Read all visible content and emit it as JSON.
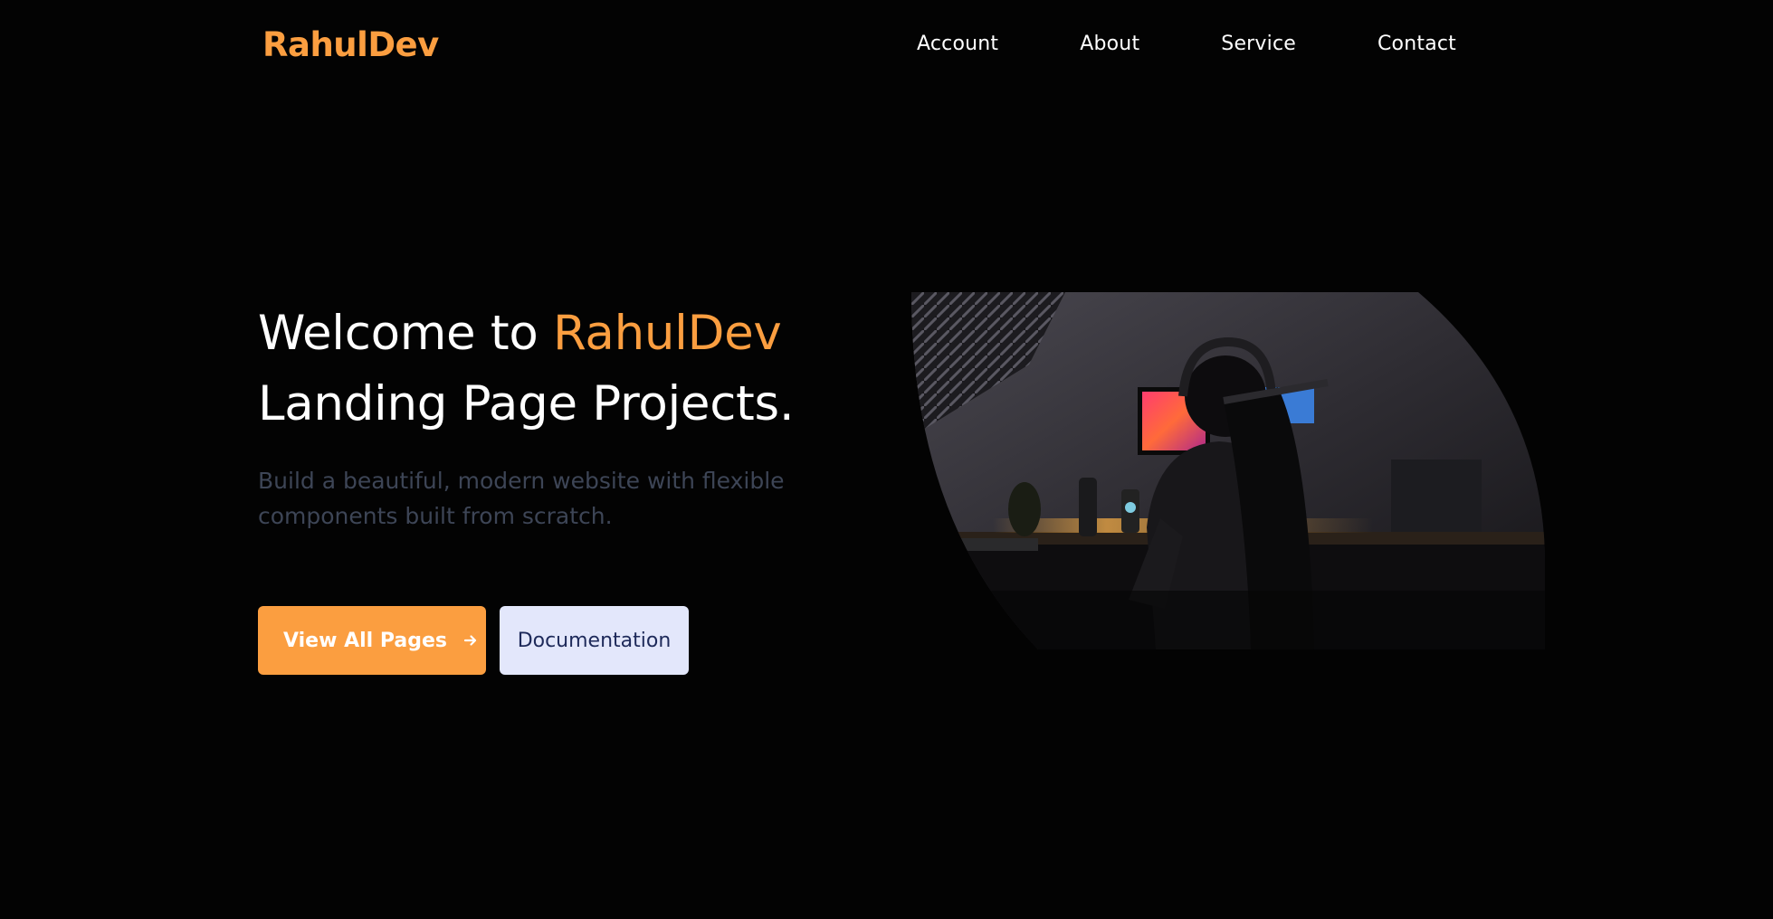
{
  "header": {
    "logo": "RahulDev",
    "nav": [
      "Account",
      "About",
      "Service",
      "Contact"
    ]
  },
  "hero": {
    "title_prefix": "Welcome to ",
    "title_accent": "RahulDev",
    "title_line2": "Landing Page Projects.",
    "subtitle": "Build a beautiful, modern website with flexible components built from scratch.",
    "primary_button": "View All Pages",
    "secondary_button": "Documentation"
  },
  "colors": {
    "accent": "#fb9e40",
    "background": "#030303",
    "subtitle": "#3d4556",
    "secondary_button_bg": "#e3e7fb",
    "secondary_button_text": "#1e2a5a"
  },
  "icons": [
    "arrow-right-icon"
  ]
}
